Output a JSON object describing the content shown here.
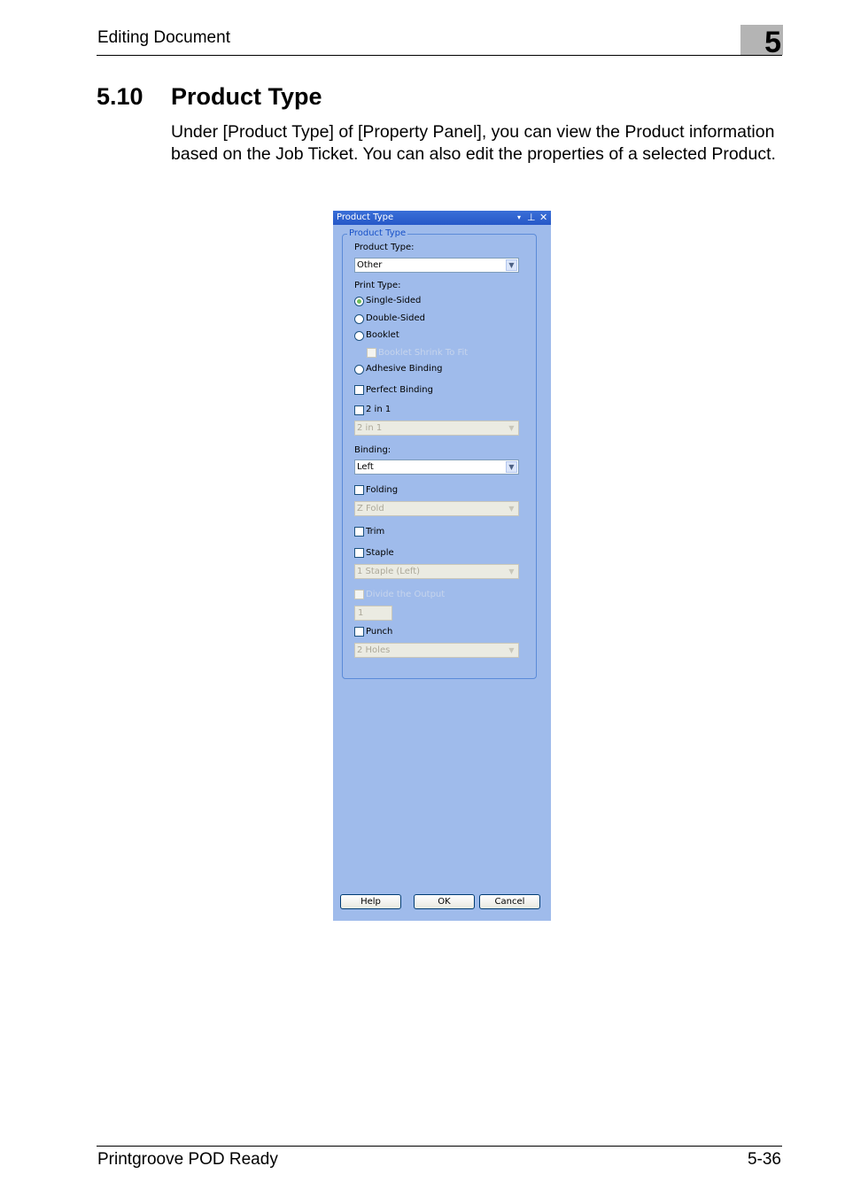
{
  "header": {
    "section": "Editing Document",
    "chapter": "5"
  },
  "section": {
    "number": "5.10",
    "title": "Product Type",
    "body": "Under [Product Type] of [Property Panel], you can view the Product information based on the Job Ticket. You can also edit the properties of a selected Product."
  },
  "panel": {
    "title": "Product Type",
    "group_label": "Product Type",
    "product_type_label": "Product Type:",
    "product_type_value": "Other",
    "print_type_label": "Print Type:",
    "radio_single": "Single-Sided",
    "radio_double": "Double-Sided",
    "radio_booklet": "Booklet",
    "booklet_shrink": "Booklet Shrink To Fit",
    "radio_adhesive": "Adhesive Binding",
    "perfect_binding": "Perfect Binding",
    "two_in_one": "2 in 1",
    "two_in_one_value": "2 in 1",
    "binding_label": "Binding:",
    "binding_value": "Left",
    "folding": "Folding",
    "folding_value": "Z Fold",
    "trim": "Trim",
    "staple": "Staple",
    "staple_value": "1 Staple (Left)",
    "divide_output": "Divide the Output",
    "divide_value": "1",
    "punch": "Punch",
    "punch_value": "2 Holes",
    "help_button": "Help",
    "ok_button": "OK",
    "cancel_button": "Cancel",
    "selected_print_type": "Single-Sided"
  },
  "footer": {
    "left": "Printgroove POD Ready",
    "page": "5-36"
  }
}
